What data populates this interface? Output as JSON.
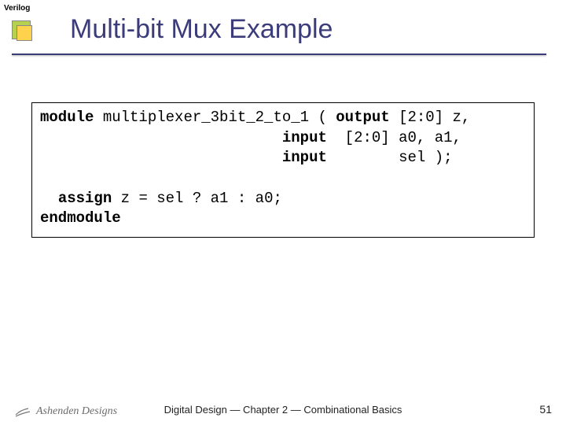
{
  "tag": "Verilog",
  "title": "Multi-bit Mux Example",
  "code": {
    "line1_kw": "module",
    "line1_rest": " multiplexer_3bit_2_to_1 ( ",
    "line1_kw2": "output",
    "line1_tail": " [2:0] z,",
    "line2_pad": "                           ",
    "line2_kw": "input",
    "line2_tail": "  [2:0] a0, a1,",
    "line3_pad": "                           ",
    "line3_kw": "input",
    "line3_tail": "        sel );",
    "line5_pad": "  ",
    "line5_kw": "assign",
    "line5_rest": " z = sel ? a1 : a0;",
    "line6_kw": "endmodule"
  },
  "footer": "Digital Design — Chapter 2 — Combinational Basics",
  "page": "51",
  "logo_text": "Ashenden Designs"
}
